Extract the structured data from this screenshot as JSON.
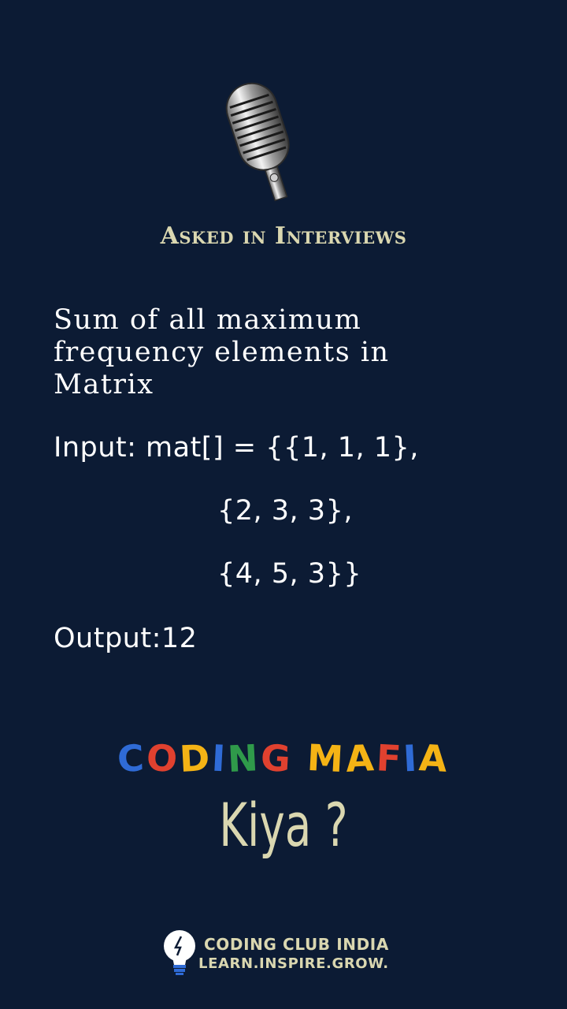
{
  "header": {
    "title": "Asked in Interviews"
  },
  "question": {
    "title": "Sum of all maximum frequency elements in Matrix",
    "input_line1": "Input: mat[] = {{1, 1, 1},",
    "input_line2": "{2, 3, 3},",
    "input_line3": "{4, 5, 3}}",
    "output": "Output:12"
  },
  "brand": {
    "letters": [
      "C",
      "O",
      "D",
      "I",
      "N",
      "G",
      " ",
      "M",
      "A",
      "F",
      "I",
      "A"
    ],
    "colors": [
      "#2f6bd6",
      "#e0412f",
      "#f4b315",
      "#2f6bd6",
      "#2f9a4a",
      "#e0412f",
      "#0c1b34",
      "#f4b315",
      "#f4b315",
      "#e0412f",
      "#2f6bd6",
      "#f4b315"
    ],
    "subtitle": "Kiya ?"
  },
  "footer": {
    "club_name": "CODING CLUB INDIA",
    "tagline": "LEARN.INSPIRE.GROW."
  },
  "icons": {
    "microphone": "microphone-icon",
    "bulb": "lightbulb-icon"
  }
}
